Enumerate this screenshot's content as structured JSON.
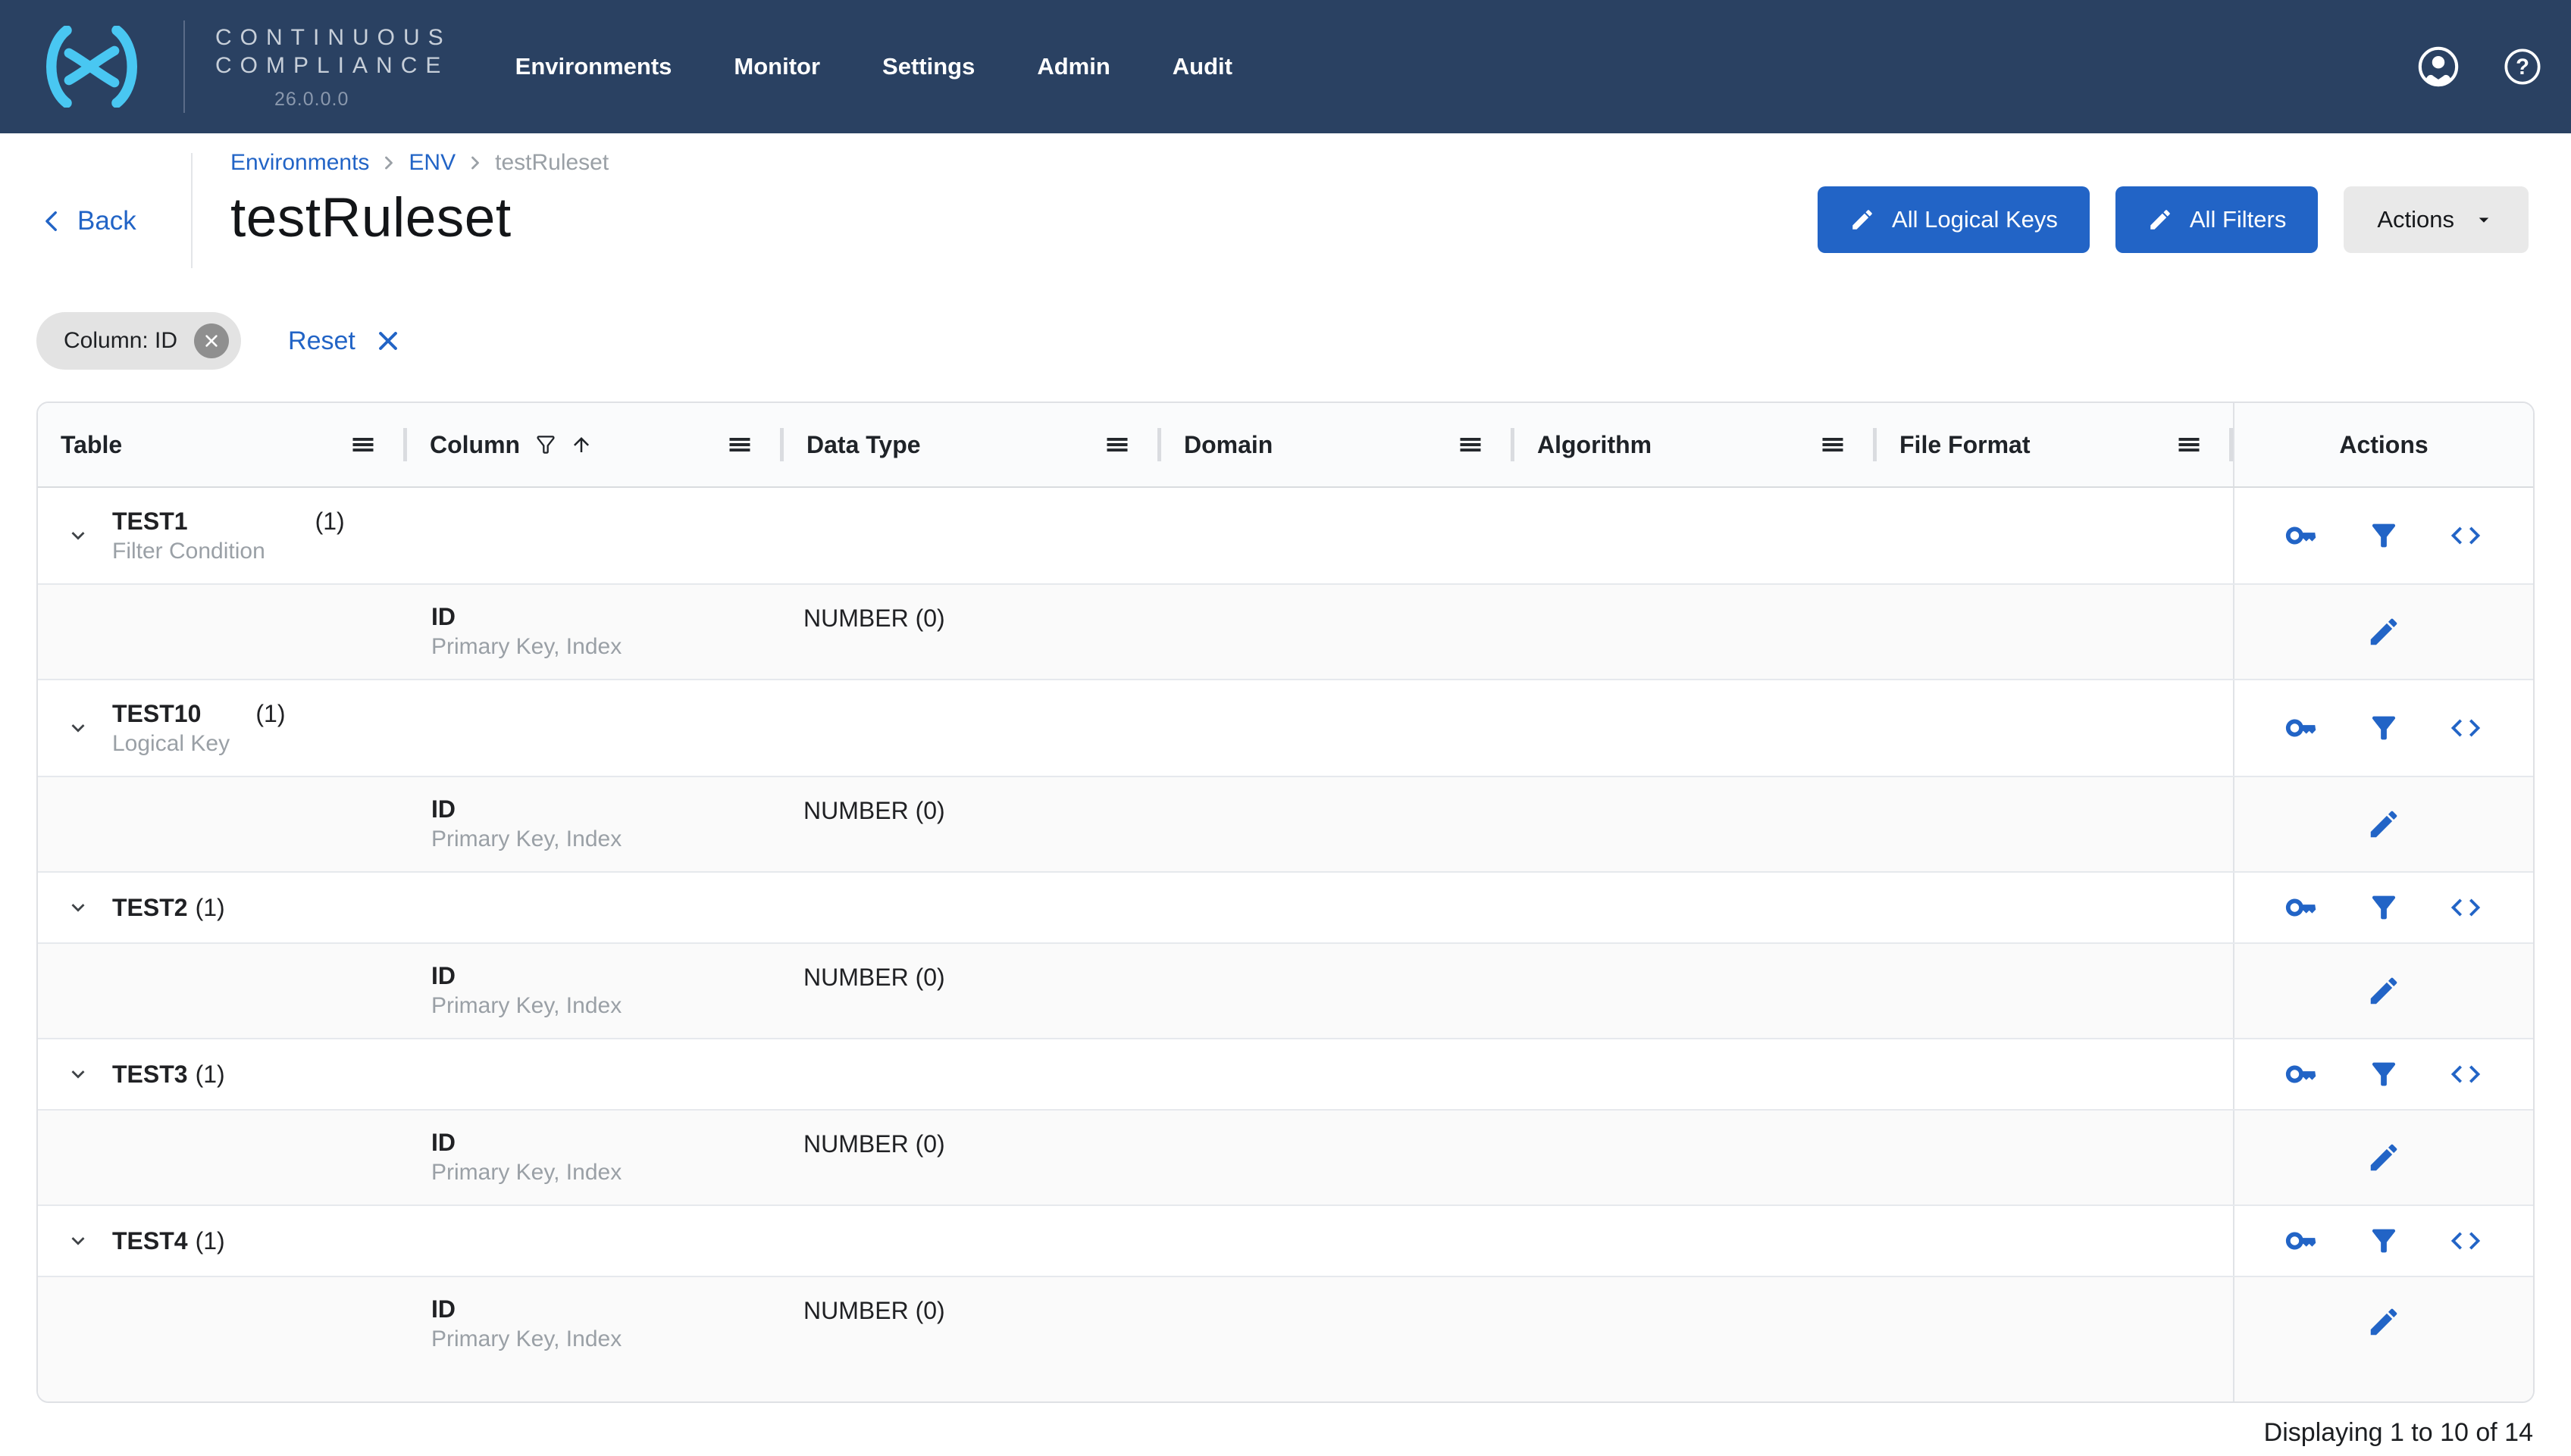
{
  "colors": {
    "navbar_bg": "#2a4162",
    "accent_blue": "#2264c6",
    "logo_cyan": "#49c7f2",
    "alt_row_bg": "#fafafa"
  },
  "navbar": {
    "brand_line1": "CONTINUOUS",
    "brand_line2": "COMPLIANCE",
    "version": "26.0.0.0",
    "items": [
      {
        "label": "Environments"
      },
      {
        "label": "Monitor"
      },
      {
        "label": "Settings"
      },
      {
        "label": "Admin"
      },
      {
        "label": "Audit"
      }
    ]
  },
  "page_header": {
    "back_label": "Back",
    "breadcrumb": [
      "Environments",
      "ENV",
      "testRuleset"
    ],
    "title": "testRuleset",
    "buttons": {
      "all_logical_keys": "All Logical Keys",
      "all_filters": "All Filters",
      "actions": "Actions"
    }
  },
  "filters": {
    "chip_label": "Column: ID",
    "reset_label": "Reset"
  },
  "table": {
    "columns": [
      "Table",
      "Column",
      "Data Type",
      "Domain",
      "Algorithm",
      "File Format",
      "Actions"
    ],
    "groups": [
      {
        "name": "TEST1",
        "count": "(1)",
        "subtitle": "Filter Condition",
        "child": {
          "column": "ID",
          "column_subtitle": "Primary Key, Index",
          "data_type": "NUMBER (0)"
        }
      },
      {
        "name": "TEST10",
        "count": "(1)",
        "subtitle": "Logical Key",
        "child": {
          "column": "ID",
          "column_subtitle": "Primary Key, Index",
          "data_type": "NUMBER (0)"
        }
      },
      {
        "name": "TEST2",
        "count": "(1)",
        "subtitle": "",
        "child": {
          "column": "ID",
          "column_subtitle": "Primary Key, Index",
          "data_type": "NUMBER (0)"
        }
      },
      {
        "name": "TEST3",
        "count": "(1)",
        "subtitle": "",
        "child": {
          "column": "ID",
          "column_subtitle": "Primary Key, Index",
          "data_type": "NUMBER (0)"
        }
      },
      {
        "name": "TEST4",
        "count": "(1)",
        "subtitle": "",
        "child": {
          "column": "ID",
          "column_subtitle": "Primary Key, Index",
          "data_type": "NUMBER (0)"
        }
      }
    ]
  },
  "footer": {
    "status": "Displaying 1 to 10 of 14"
  }
}
